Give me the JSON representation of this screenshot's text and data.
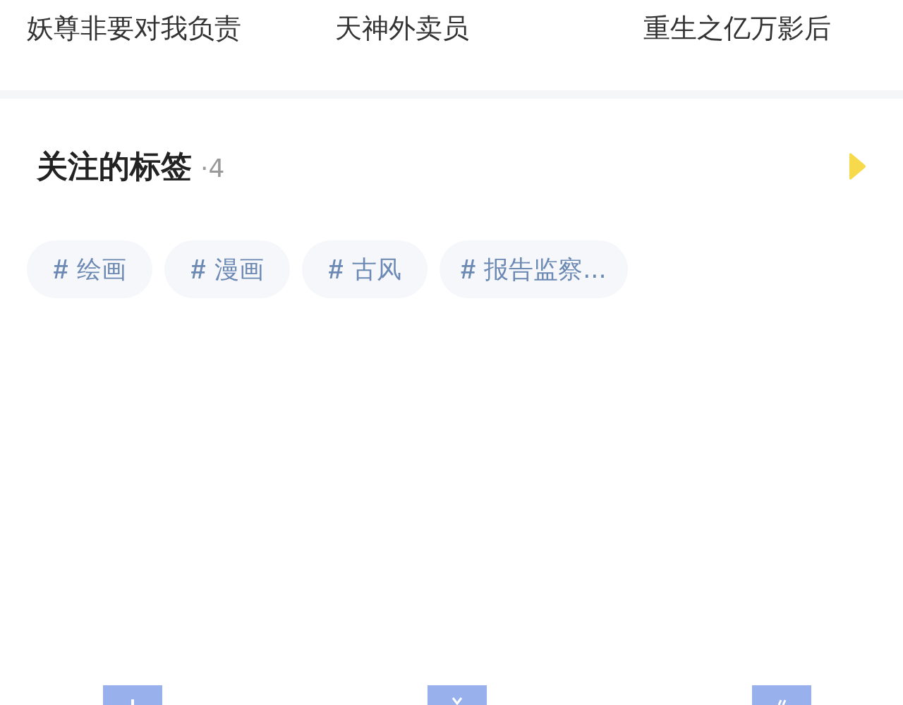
{
  "book_titles": [
    {
      "title": "妖尊非要对我负责"
    },
    {
      "title": "天神外卖员"
    },
    {
      "title": "重生之亿万影后"
    }
  ],
  "followed_tags": {
    "title": "关注的标签",
    "count": "·4",
    "tags": [
      {
        "symbol": "#",
        "label": "绘画"
      },
      {
        "symbol": "#",
        "label": "漫画"
      },
      {
        "symbol": "#",
        "label": "古风"
      },
      {
        "symbol": "#",
        "label": "报告监察..."
      }
    ]
  }
}
